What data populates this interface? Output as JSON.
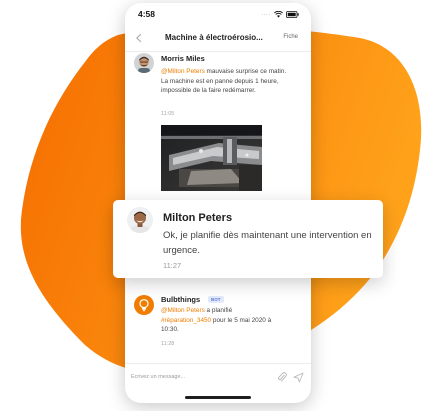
{
  "status_bar": {
    "time": "4:58",
    "signal_dots": "...."
  },
  "nav": {
    "title": "Machine à électroérosio...",
    "action": "Fiche"
  },
  "messages": [
    {
      "sender": "Morris Miles",
      "mention": "@Milton Peters",
      "text": " mauvaise surprise ce matin. La machine est en panne depuis 1 heure, impossible de la faire redémarrer.",
      "time": "11:05"
    }
  ],
  "highlighted_message": {
    "sender": "Milton Peters",
    "text": "Ok, je planifie dès maintenant une intervention en urgence.",
    "time": "11:27"
  },
  "bot_message": {
    "sender": "Bulbthings",
    "badge": "BOT",
    "mention": "@Milton Peters",
    "text_1": " a planifié ",
    "tag": "#réparation_3450",
    "text_2": " pour le 5 mai 2020 à 10:30.",
    "time": "11:28"
  },
  "composer": {
    "placeholder": "Ecrivez un message..."
  },
  "colors": {
    "accent": "#f07c00",
    "blob_light": "#ffa21a",
    "blob_dark": "#f56d00"
  },
  "icons": [
    "wifi-icon",
    "battery-icon",
    "back-chevron-icon",
    "paperclip-icon",
    "send-icon",
    "lightbulb-icon"
  ]
}
